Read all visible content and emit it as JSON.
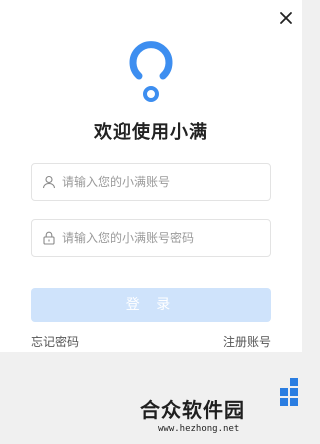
{
  "dialog": {
    "title": "欢迎使用小满",
    "username": {
      "placeholder": "请输入您的小满账号",
      "value": ""
    },
    "password": {
      "placeholder": "请输入您的小满账号密码",
      "value": ""
    },
    "login_label": "登 录",
    "forgot_label": "忘记密码",
    "register_label": "注册账号"
  },
  "watermark": {
    "brand": "合众软件园",
    "url": "www.hezhong.net"
  },
  "colors": {
    "accent": "#3d8ef0",
    "button_disabled": "#cfe3fb"
  }
}
